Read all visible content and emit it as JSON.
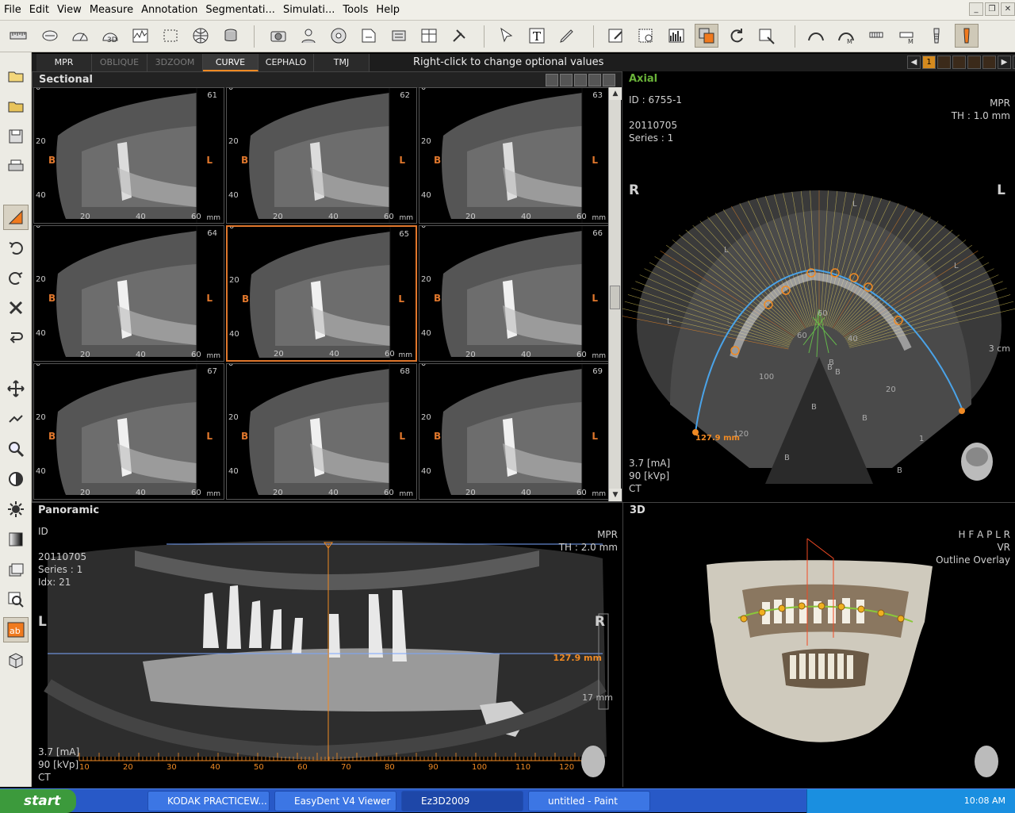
{
  "menu": [
    "File",
    "Edit",
    "View",
    "Measure",
    "Annotation",
    "Segmentati...",
    "Simulati...",
    "Tools",
    "Help"
  ],
  "tabs": [
    {
      "label": "MPR",
      "state": "normal"
    },
    {
      "label": "OBLIQUE",
      "state": "dim"
    },
    {
      "label": "3DZOOM",
      "state": "dim"
    },
    {
      "label": "CURVE",
      "state": "selected"
    },
    {
      "label": "CEPHALO",
      "state": "normal"
    },
    {
      "label": "TMJ",
      "state": "normal"
    }
  ],
  "hint": "Right-click to change optional values",
  "pager": {
    "current": "1"
  },
  "sectional": {
    "title": "Sectional",
    "labels": {
      "buccal": "B",
      "lingual": "L",
      "unit": "mm"
    },
    "y_ticks": [
      "0",
      "20",
      "40"
    ],
    "x_ticks": [
      "20",
      "40",
      "60"
    ],
    "slices": [
      {
        "num": "61",
        "selected": false
      },
      {
        "num": "62",
        "selected": false
      },
      {
        "num": "63",
        "selected": false
      },
      {
        "num": "64",
        "selected": false
      },
      {
        "num": "65",
        "selected": true
      },
      {
        "num": "66",
        "selected": false
      },
      {
        "num": "67",
        "selected": false
      },
      {
        "num": "68",
        "selected": false
      },
      {
        "num": "69",
        "selected": false
      }
    ]
  },
  "axial": {
    "title": "Axial",
    "id": "ID : 6755-1",
    "date": "20110705",
    "series": "Series : 1",
    "mode": "MPR",
    "thickness": "TH : 1.0 mm",
    "orient_left": "R",
    "orient_right": "L",
    "scale": "3 cm",
    "arch_length": "127.9 mm",
    "markers": [
      "100",
      "120",
      "60",
      "60",
      "40",
      "20",
      "1",
      "L",
      "L",
      "L",
      "L",
      "B",
      "B",
      "B",
      "B",
      "B",
      "B",
      "B"
    ],
    "ma": "3.7 [mA]",
    "kvp": "90 [kVp]",
    "modality": "CT"
  },
  "panoramic": {
    "title": "Panoramic",
    "id": "ID",
    "date": "20110705",
    "series": "Series : 1",
    "idx": "Idx: 21",
    "mode": "MPR",
    "thickness": "TH : 2.0 mm",
    "orient_left": "L",
    "orient_right": "R",
    "measure": "127.9 mm",
    "depth": "17 mm",
    "ruler": [
      "10",
      "20",
      "30",
      "40",
      "50",
      "60",
      "70",
      "80",
      "90",
      "100",
      "110",
      "120"
    ],
    "ma": "3.7 [mA]",
    "kvp": "90 [kVp]",
    "modality": "CT"
  },
  "three_d": {
    "title": "3D",
    "orient": "H F A P L R",
    "render": "VR",
    "overlay": "Outline Overlay"
  },
  "taskbar": {
    "start": "start",
    "tasks": [
      "KODAK PRACTICEW...",
      "EasyDent V4 Viewer",
      "Ez3D2009",
      "untitled - Paint"
    ],
    "active_task": "Ez3D2009",
    "clock": "10:08 AM"
  }
}
